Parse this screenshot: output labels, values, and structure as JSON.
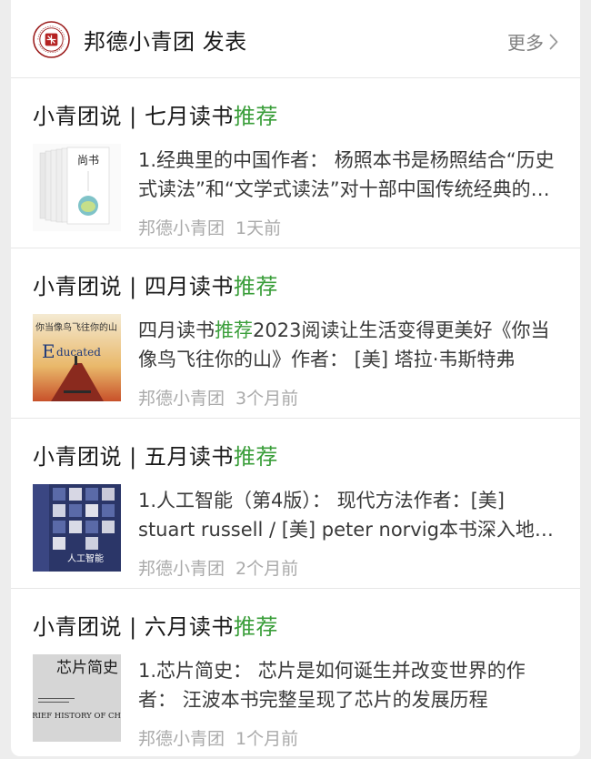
{
  "header": {
    "title": "邦德小青团 发表",
    "more_label": "更多",
    "logo_text": "四川邦德学院"
  },
  "articles": [
    {
      "title_main": "小青团说 | 七月读书",
      "title_accent": "推荐",
      "summary": "1.经典里的中国作者： 杨照本书是杨照结合“历史式读法”和“文学式读法”对十部中国传统经典的精读",
      "summary_prefix": "",
      "summary_accent": "",
      "author": "邦德小青团",
      "time": "1天前",
      "cover": {
        "title": "尚书"
      }
    },
    {
      "title_main": "小青团说 | 四月读书",
      "title_accent": "推荐",
      "summary_prefix": "四月读书",
      "summary_accent": "推荐",
      "summary": "2023阅读让生活变得更美好《你当像鸟飞往你的山》作者： [美] 塔拉·韦斯特弗",
      "author": "邦德小青团",
      "time": "3个月前",
      "cover": {
        "title_cn": "你当像鸟飞往你的山",
        "title_en_big": "E",
        "title_en_rest": "ducated"
      }
    },
    {
      "title_main": "小青团说 | 五月读书",
      "title_accent": "推荐",
      "summary_prefix": "",
      "summary_accent": "",
      "summary": "1.人工智能（第4版）： 现代方法作者：[美] stuart russell / [美] peter norvig本书深入地介绍了人工智能",
      "author": "邦德小青团",
      "time": "2个月前",
      "cover": {
        "title": "人工智能"
      }
    },
    {
      "title_main": "小青团说 | 六月读书",
      "title_accent": "推荐",
      "summary_prefix": "",
      "summary_accent": "",
      "summary": "1.芯片简史： 芯片是如何诞生并改变世界的作者： 汪波本书完整呈现了芯片的发展历程",
      "author": "邦德小青团",
      "time": "1个月前",
      "cover": {
        "title_cn": "芯片简史",
        "title_en": "A BRIEF HISTORY OF CHIPS"
      }
    }
  ]
}
